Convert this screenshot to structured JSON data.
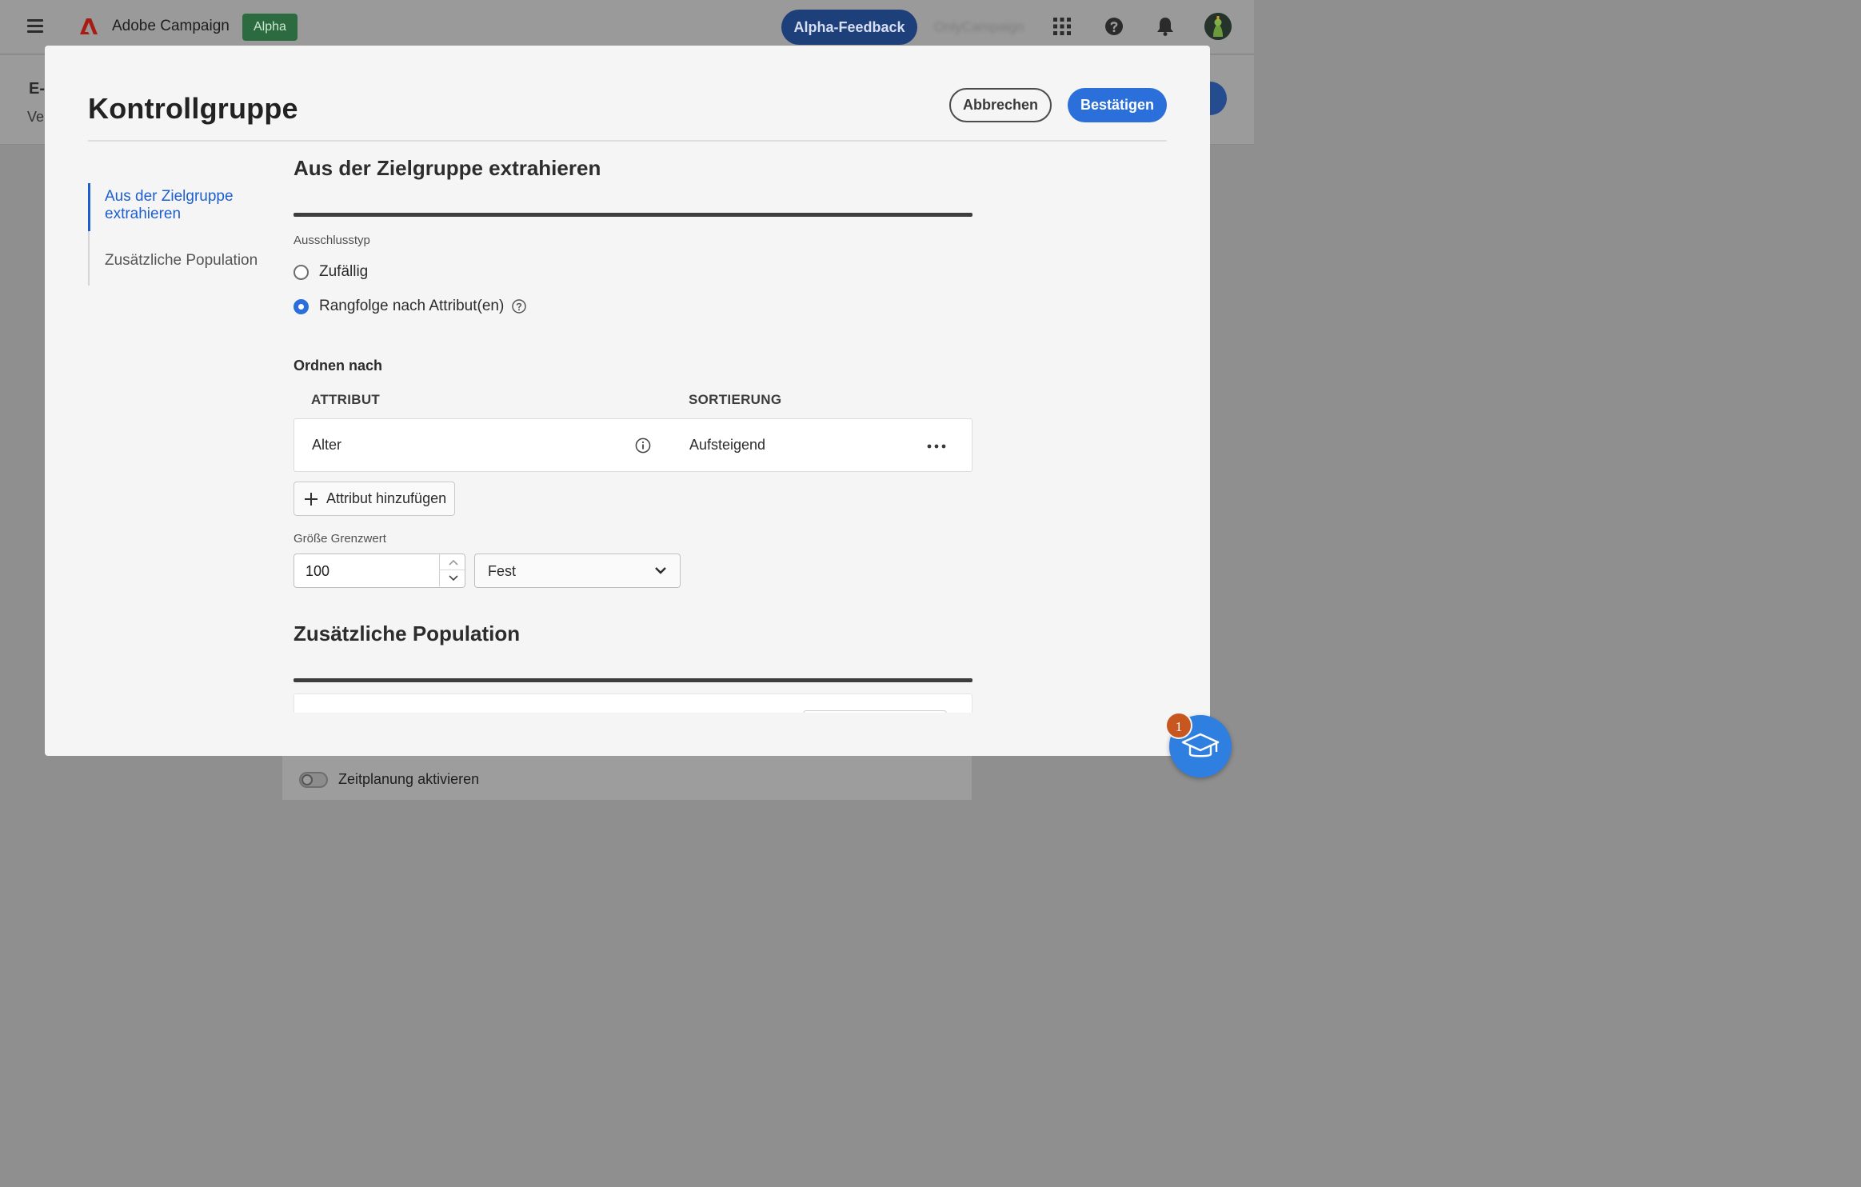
{
  "topbar": {
    "app_title": "Adobe Campaign",
    "alpha_badge": "Alpha",
    "feedback_button": "Alpha-Feedback",
    "org_name": "OnlyCampaign",
    "icons": [
      "hamburger-menu-icon",
      "adobe-logo-icon",
      "app-switcher-icon",
      "help-icon",
      "notification-bell-icon",
      "user-avatar"
    ]
  },
  "background": {
    "title": "E-",
    "subtitle": "Ve",
    "toggle_label": "Zeitplanung aktivieren"
  },
  "modal": {
    "title": "Kontrollgruppe",
    "cancel_label": "Abbrechen",
    "confirm_label": "Bestätigen",
    "nav": [
      {
        "label": "Aus der Zielgruppe extrahieren",
        "active": true
      },
      {
        "label": "Zusätzliche Population",
        "active": false
      }
    ],
    "extract": {
      "title": "Aus der Zielgruppe extrahieren",
      "exclusion_type_label": "Ausschlusstyp",
      "options": [
        {
          "label": "Zufällig",
          "selected": false
        },
        {
          "label": "Rangfolge nach Attribut(en)",
          "selected": true
        }
      ],
      "order_by_label": "Ordnen nach",
      "columns": [
        "ATTRIBUT",
        "SORTIERUNG"
      ],
      "rows": [
        {
          "attribute": "Alter",
          "sort": "Aufsteigend"
        }
      ],
      "add_attribute_label": "Attribut hinzufügen",
      "size_limit_label": "Größe Grenzwert",
      "size_limit_value": "100",
      "size_type_value": "Fest"
    },
    "additional": {
      "title": "Zusätzliche Population"
    }
  },
  "learn_badge_count": "1",
  "colors": {
    "accent": "#2b6fdb",
    "nav_active": "#1d5fcf",
    "badge": "#c8571f",
    "alpha_green": "#2c6b3f"
  }
}
